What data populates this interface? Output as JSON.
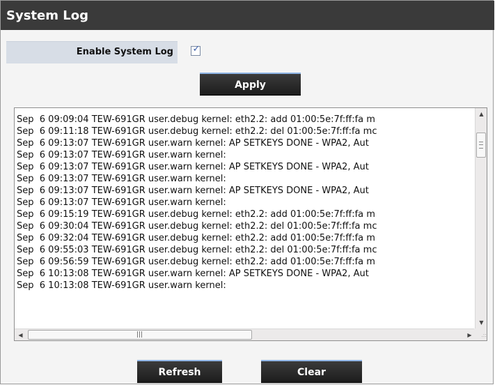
{
  "title": "System Log",
  "enable_system_log": {
    "label": "Enable System Log",
    "checked": true
  },
  "buttons": {
    "apply": "Apply",
    "refresh": "Refresh",
    "clear": "Clear"
  },
  "log_lines": [
    "Sep  6 09:09:04 TEW-691GR user.debug kernel: eth2.2: add 01:00:5e:7f:ff:fa m",
    "Sep  6 09:11:18 TEW-691GR user.debug kernel: eth2.2: del 01:00:5e:7f:ff:fa mc",
    "Sep  6 09:13:07 TEW-691GR user.warn kernel: AP SETKEYS DONE - WPA2, Aut",
    "Sep  6 09:13:07 TEW-691GR user.warn kernel:",
    "Sep  6 09:13:07 TEW-691GR user.warn kernel: AP SETKEYS DONE - WPA2, Aut",
    "Sep  6 09:13:07 TEW-691GR user.warn kernel:",
    "Sep  6 09:13:07 TEW-691GR user.warn kernel: AP SETKEYS DONE - WPA2, Aut",
    "Sep  6 09:13:07 TEW-691GR user.warn kernel:",
    "Sep  6 09:15:19 TEW-691GR user.debug kernel: eth2.2: add 01:00:5e:7f:ff:fa m",
    "Sep  6 09:30:04 TEW-691GR user.debug kernel: eth2.2: del 01:00:5e:7f:ff:fa mc",
    "Sep  6 09:32:04 TEW-691GR user.debug kernel: eth2.2: add 01:00:5e:7f:ff:fa m",
    "Sep  6 09:55:03 TEW-691GR user.debug kernel: eth2.2: del 01:00:5e:7f:ff:fa mc",
    "Sep  6 09:56:59 TEW-691GR user.debug kernel: eth2.2: add 01:00:5e:7f:ff:fa m",
    "Sep  6 10:13:08 TEW-691GR user.warn kernel: AP SETKEYS DONE - WPA2, Aut",
    "Sep  6 10:13:08 TEW-691GR user.warn kernel:"
  ],
  "icons": {
    "checkbox_check": "check-icon",
    "scroll_up": "arrow-up-icon",
    "scroll_down": "arrow-down-icon",
    "scroll_left": "arrow-left-icon",
    "scroll_right": "arrow-right-icon"
  },
  "colors": {
    "header_bg": "#3a3a3a",
    "label_row_bg": "#d7dde6",
    "button_accent": "#8fb5e6"
  }
}
